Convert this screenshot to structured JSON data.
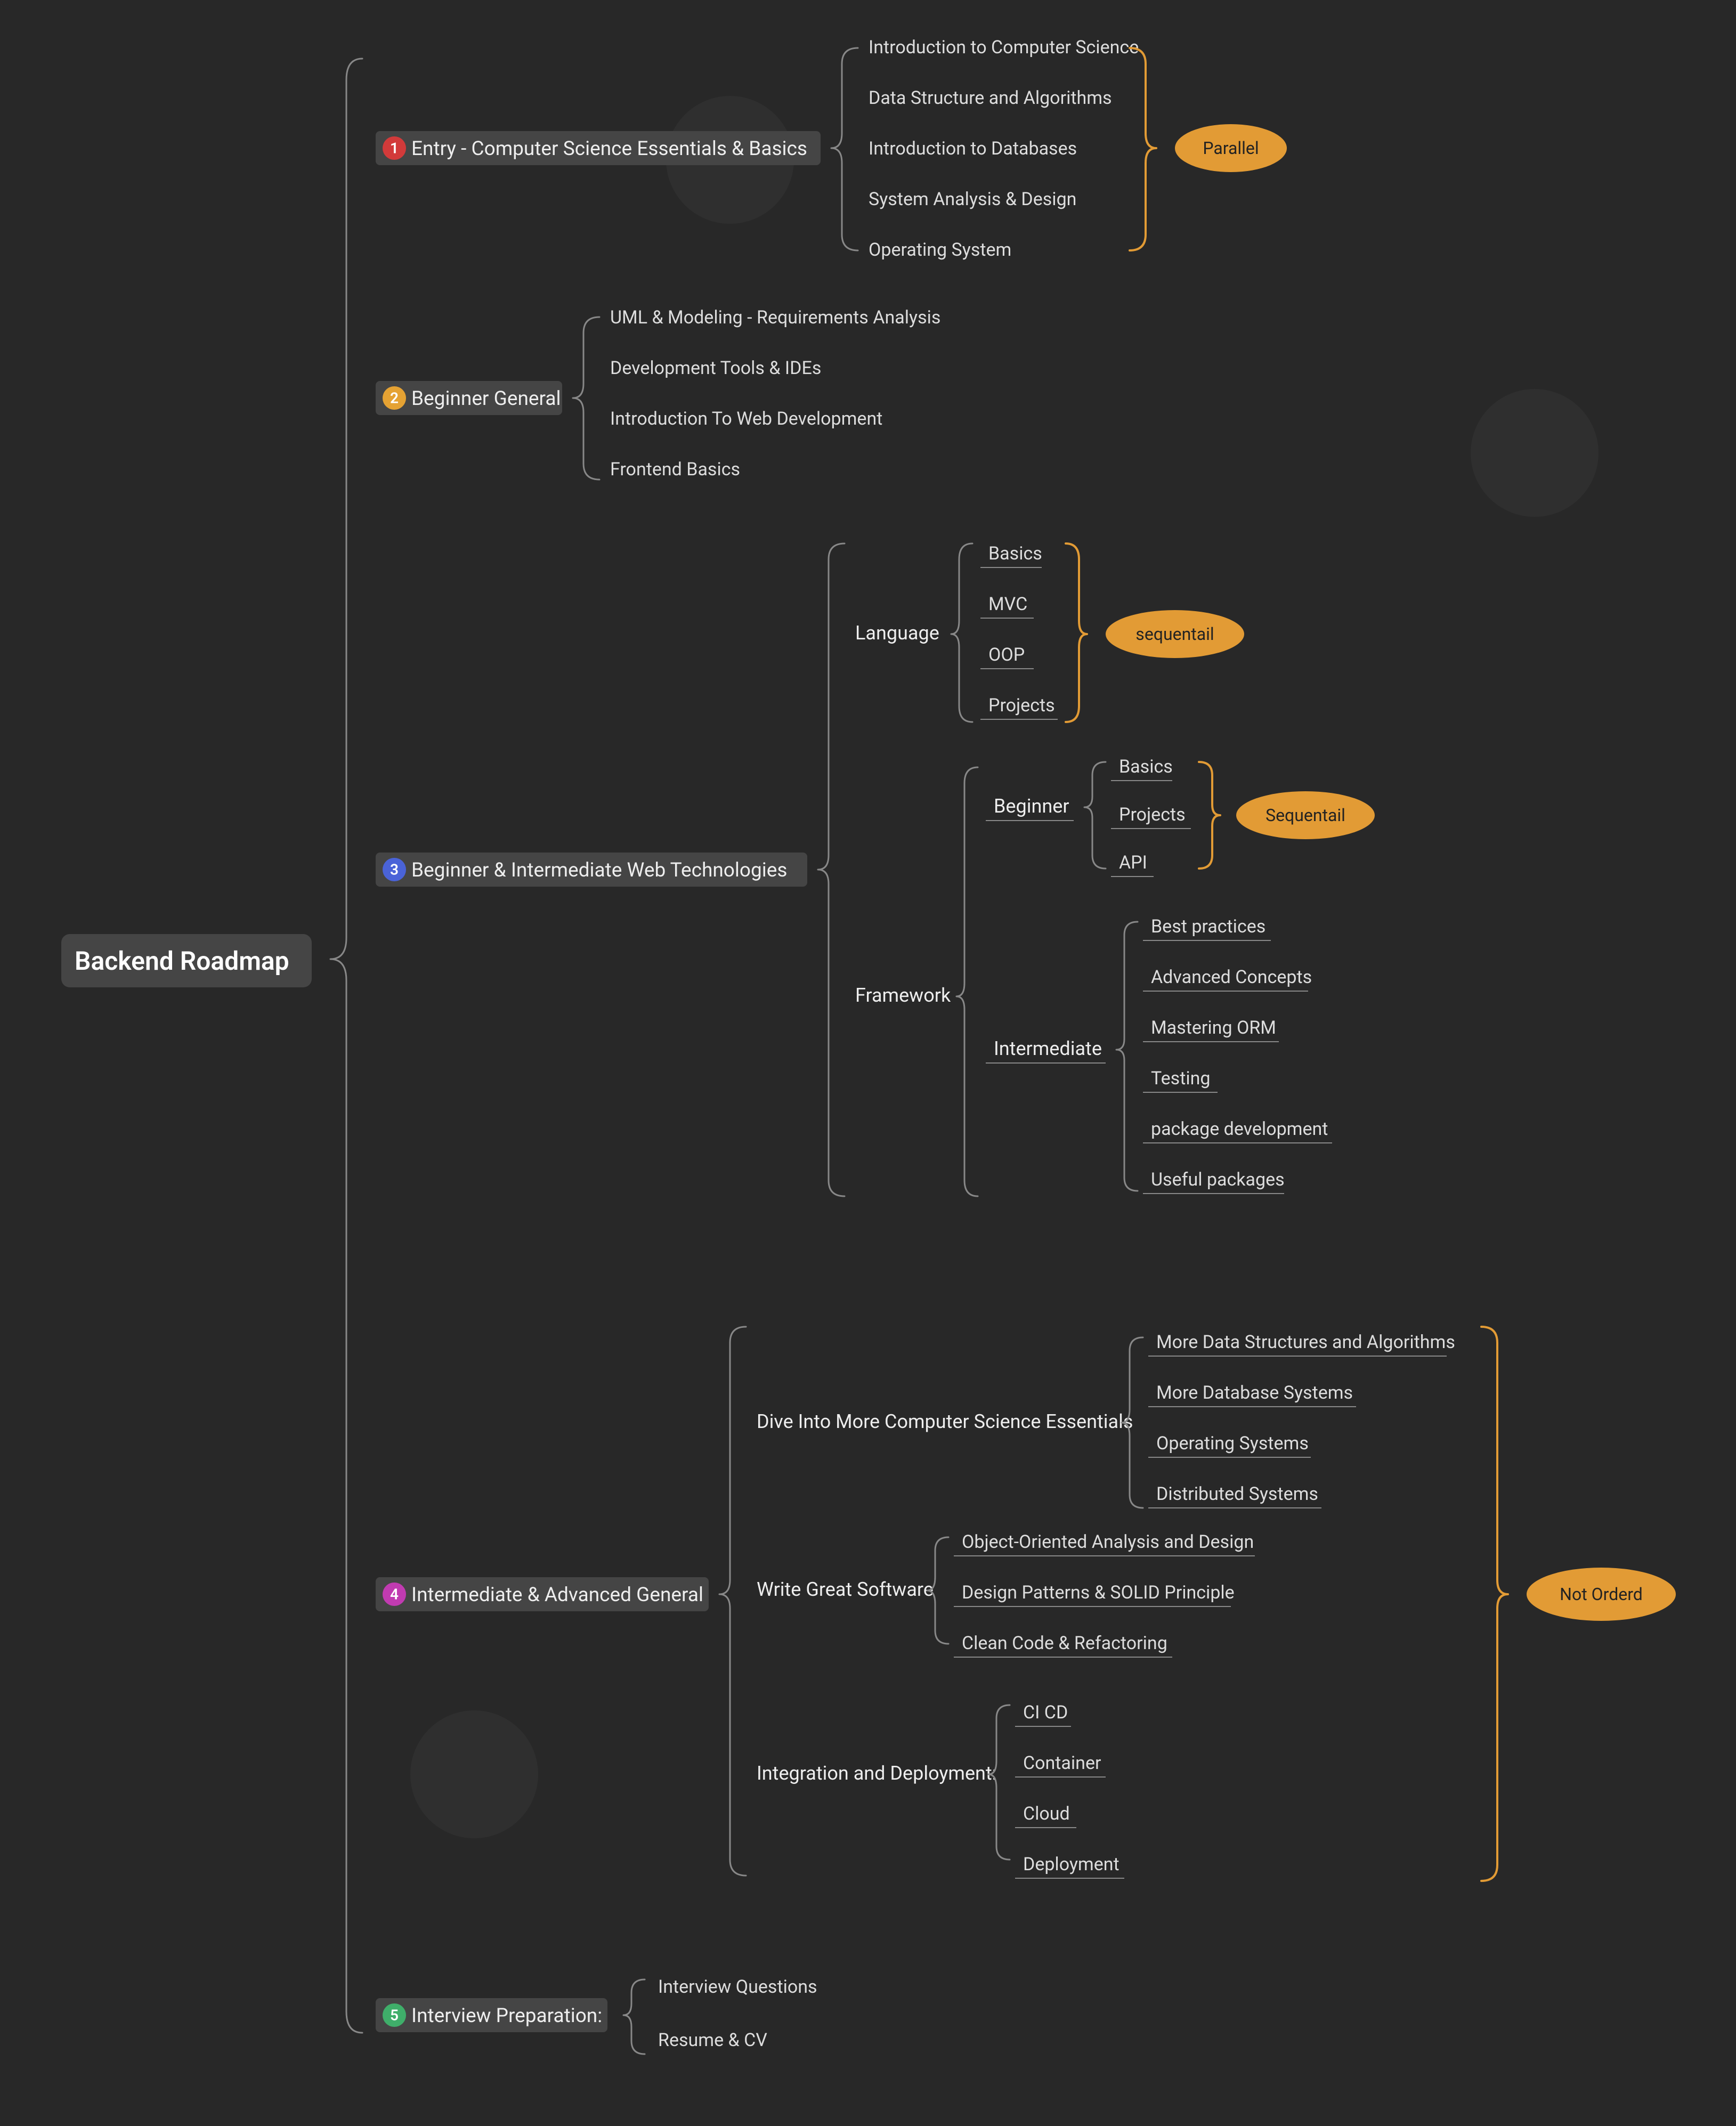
{
  "root": "Backend Roadmap",
  "badges": {
    "s1": {
      "num": "1",
      "color": "#D23A3A",
      "label": "Entry - Computer Science Essentials & Basics"
    },
    "s2": {
      "num": "2",
      "color": "#E5A233",
      "label": "Beginner General"
    },
    "s3": {
      "num": "3",
      "color": "#4A63D8",
      "label": "Beginner & Intermediate Web Technologies"
    },
    "s4": {
      "num": "4",
      "color": "#C13BB1",
      "label": "Intermediate & Advanced General"
    },
    "s5": {
      "num": "5",
      "color": "#3FAE6A",
      "label": "Interview Preparation:"
    }
  },
  "s1_items": [
    "Introduction to Computer Science",
    "Data Structure and Algorithms",
    "Introduction to Databases",
    "System Analysis & Design",
    "Operating System"
  ],
  "s1_tag": "Parallel",
  "s2_items": [
    "UML & Modeling - Requirements Analysis",
    "Development Tools & IDEs",
    "Introduction To Web Development",
    "Frontend Basics"
  ],
  "s3": {
    "language_label": "Language",
    "language_items": [
      "Basics",
      "MVC",
      "OOP",
      "Projects"
    ],
    "language_tag": "sequentail",
    "framework_label": "Framework",
    "fw_beginner_label": "Beginner",
    "fw_beginner_items": [
      "Basics",
      "Projects",
      "API"
    ],
    "fw_beginner_tag": "Sequentail",
    "fw_intermediate_label": "Intermediate",
    "fw_intermediate_items": [
      "Best practices",
      "Advanced Concepts",
      "Mastering ORM",
      "Testing",
      "package development",
      "Useful packages"
    ]
  },
  "s4": {
    "a_label": "Dive Into More Computer Science Essentials",
    "a_items": [
      "More Data Structures and Algorithms",
      "More Database Systems",
      "Operating Systems",
      "Distributed Systems"
    ],
    "b_label": "Write Great Software",
    "b_items": [
      "Object-Oriented Analysis and Design",
      "Design Patterns & SOLID Principle",
      "Clean Code & Refactoring"
    ],
    "c_label": "Integration and Deployment:",
    "c_items": [
      "CI CD",
      "Container",
      "Cloud",
      "Deployment"
    ],
    "tag": "Not Orderd"
  },
  "s5_items": [
    "Interview Questions",
    "Resume & CV"
  ]
}
